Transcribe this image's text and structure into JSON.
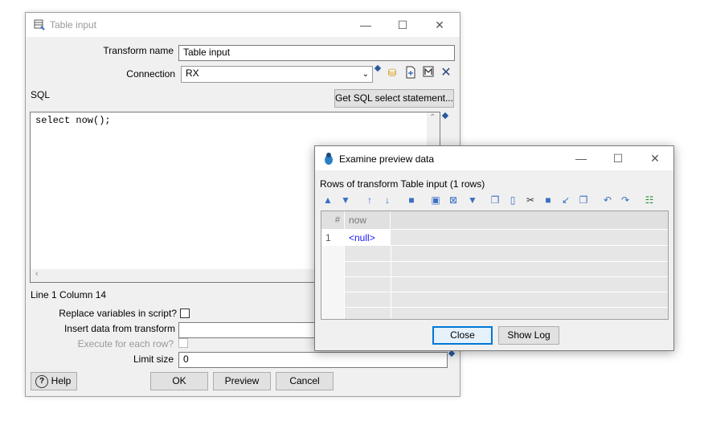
{
  "main_dialog": {
    "title": "Table input",
    "transform_name_label": "Transform name",
    "transform_name_value": "Table input",
    "connection_label": "Connection",
    "connection_value": "RX",
    "sql_label": "SQL",
    "get_sql_button": "Get SQL select statement...",
    "sql_text": "select now();",
    "cursor_position": "Line 1 Column 14",
    "replace_variables_label": "Replace variables in script?",
    "insert_data_label": "Insert data from transform",
    "execute_each_row_label": "Execute for each row?",
    "limit_size_label": "Limit size",
    "limit_size_value": "0",
    "help_button": "Help",
    "ok_button": "OK",
    "preview_button": "Preview",
    "cancel_button": "Cancel"
  },
  "preview_dialog": {
    "title": "Examine preview data",
    "rows_label": "Rows of transform Table input (1 rows)",
    "columns": [
      "#",
      "now"
    ],
    "rows": [
      [
        "1",
        "<null>"
      ]
    ],
    "close_button": "Close",
    "show_log_button": "Show Log"
  },
  "colors": {
    "accent_blue": "#3a6fc4",
    "null_value": "#1a1aff",
    "default_button_border": "#0078d7"
  }
}
